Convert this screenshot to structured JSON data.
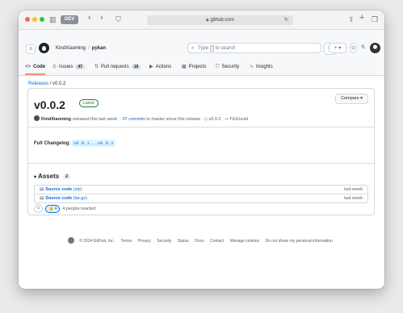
{
  "browser": {
    "profile_label": "DEV",
    "url": "github.com"
  },
  "header": {
    "owner": "KindXiaoming",
    "separator": "/",
    "repo": "pykan",
    "search_placeholder_pre": "Type",
    "search_placeholder_key": "/",
    "search_placeholder_post": "to search",
    "new_label": "+ ▾"
  },
  "tabs": [
    {
      "label": "Code",
      "icon": "<>",
      "count": ""
    },
    {
      "label": "Issues",
      "icon": "⊙",
      "count": "47"
    },
    {
      "label": "Pull requests",
      "icon": "⇅",
      "count": "16"
    },
    {
      "label": "Actions",
      "icon": "▶",
      "count": ""
    },
    {
      "label": "Projects",
      "icon": "▦",
      "count": ""
    },
    {
      "label": "Security",
      "icon": "⛉",
      "count": ""
    },
    {
      "label": "Insights",
      "icon": "∿",
      "count": ""
    }
  ],
  "breadcrumb": {
    "releases": "Releases",
    "sep": "/",
    "current": "v0.0.2"
  },
  "release": {
    "title": "v0.0.2",
    "badge": "Latest",
    "compare_label": "Compare",
    "author": "KindXiaoming",
    "released_text": "released this last week",
    "commits_link": "· 97 commits",
    "commits_text": "to master since this release",
    "tag": "v0.0.2",
    "commit": "f832e48",
    "changelog_label": "Full Changelog:",
    "changelog_link": "v0.0.1...v0.0.2"
  },
  "assets": {
    "title": "Assets",
    "count": "2",
    "items": [
      {
        "name": "Source code",
        "ext": "(zip)",
        "when": "last week"
      },
      {
        "name": "Source code",
        "ext": "(tar.gz)",
        "when": "last week"
      }
    ]
  },
  "reactions": {
    "thumb": "👍 4",
    "text": "4 people reacted"
  },
  "footer": {
    "copyright": "© 2024 GitHub, Inc.",
    "links": [
      "Terms",
      "Privacy",
      "Security",
      "Status",
      "Docs",
      "Contact",
      "Manage cookies",
      "Do not share my personal information"
    ]
  },
  "colors": {
    "accent_link": "#0969da",
    "active_tab_underline": "#fd8c73",
    "latest_badge": "#1a7f37"
  }
}
